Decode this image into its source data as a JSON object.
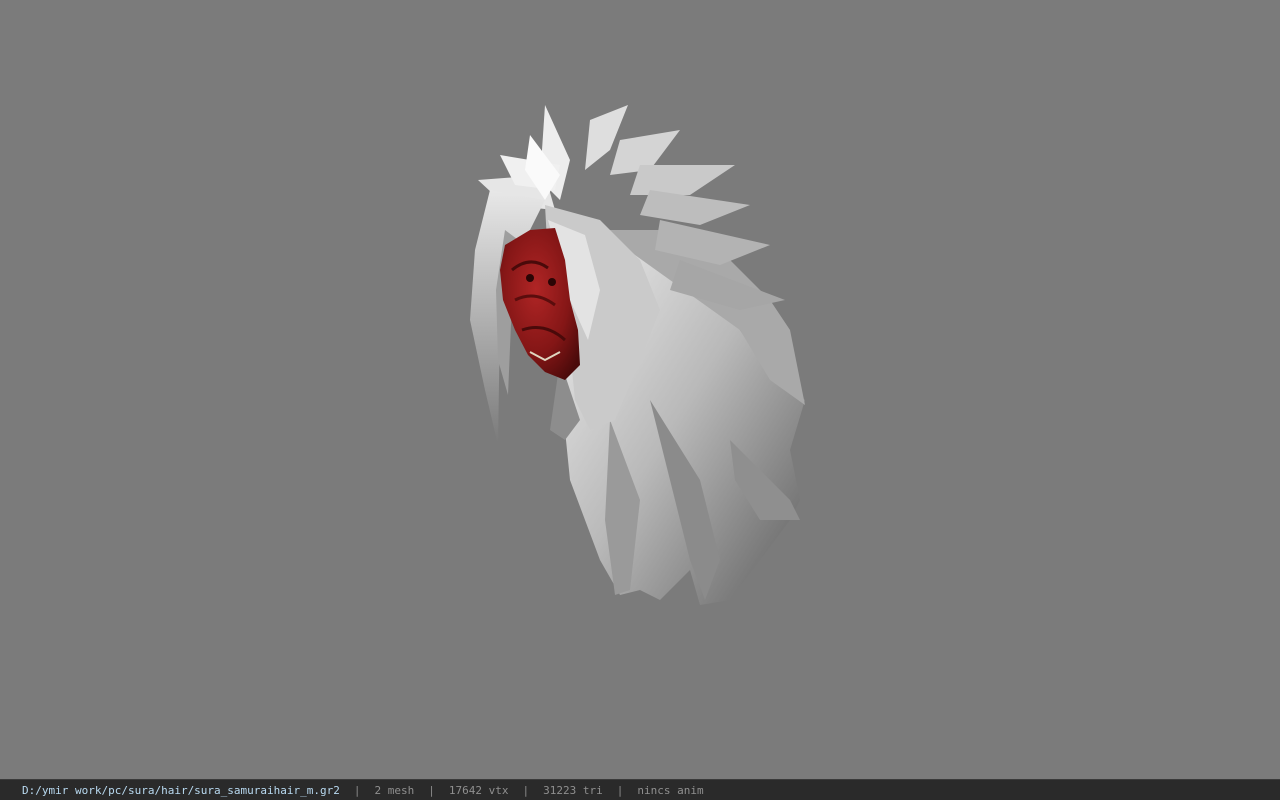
{
  "viewport": {
    "background_color": "#7b7b7b",
    "model": {
      "description_icon": "hair-mesh-model",
      "hair_color": "#cfcfcf",
      "mask_color": "#8a1a1a"
    }
  },
  "status_bar": {
    "file_path": "D:/ymir work/pc/sura/hair/sura_samuraihair_m.gr2",
    "separator": "|",
    "mesh_count": "2 mesh",
    "vertex_count": "17642 vtx",
    "triangle_count": "31223 tri",
    "anim_status": "nincs anim",
    "path_color": "#b8d9f0"
  }
}
